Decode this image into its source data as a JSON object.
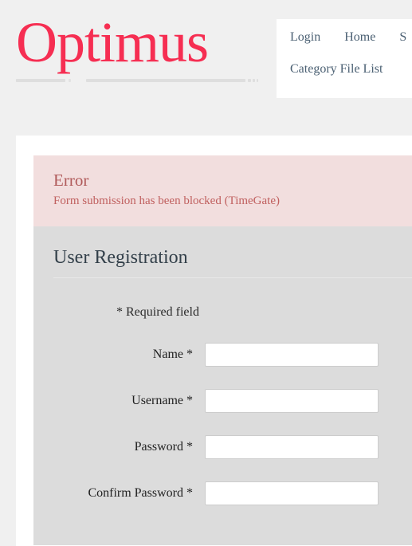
{
  "brand": {
    "name": "Optimus"
  },
  "nav": {
    "items": [
      {
        "label": "Login",
        "name": "nav-link-login"
      },
      {
        "label": "Home",
        "name": "nav-link-home"
      },
      {
        "label": "S",
        "name": "nav-link-search-truncated"
      },
      {
        "label": "Category File List",
        "name": "nav-link-category-file-list"
      }
    ]
  },
  "alert": {
    "type": "error",
    "title": "Error",
    "message": "Form submission has been blocked (TimeGate)",
    "background_color": "#f2dede",
    "title_color": "#b05a5a",
    "text_color": "#c0605f"
  },
  "panel": {
    "title": "User Registration",
    "background_color": "#dcdcdc",
    "required_note": "* Required field",
    "fields": [
      {
        "label": "Name *",
        "value": "",
        "placeholder": "",
        "type": "text",
        "name": "name-field"
      },
      {
        "label": "Username *",
        "value": "",
        "placeholder": "",
        "type": "text",
        "name": "username-field"
      },
      {
        "label": "Password *",
        "value": "",
        "placeholder": "",
        "type": "password",
        "name": "password-field"
      },
      {
        "label": "Confirm Password *",
        "value": "",
        "placeholder": "",
        "type": "password",
        "name": "confirm-password-field"
      }
    ]
  },
  "theme": {
    "page_background": "#f0f0f0",
    "content_background": "#ffffff",
    "brand_color": "#f62e52",
    "nav_link_color": "#4b6073",
    "heading_color": "#33404a"
  }
}
